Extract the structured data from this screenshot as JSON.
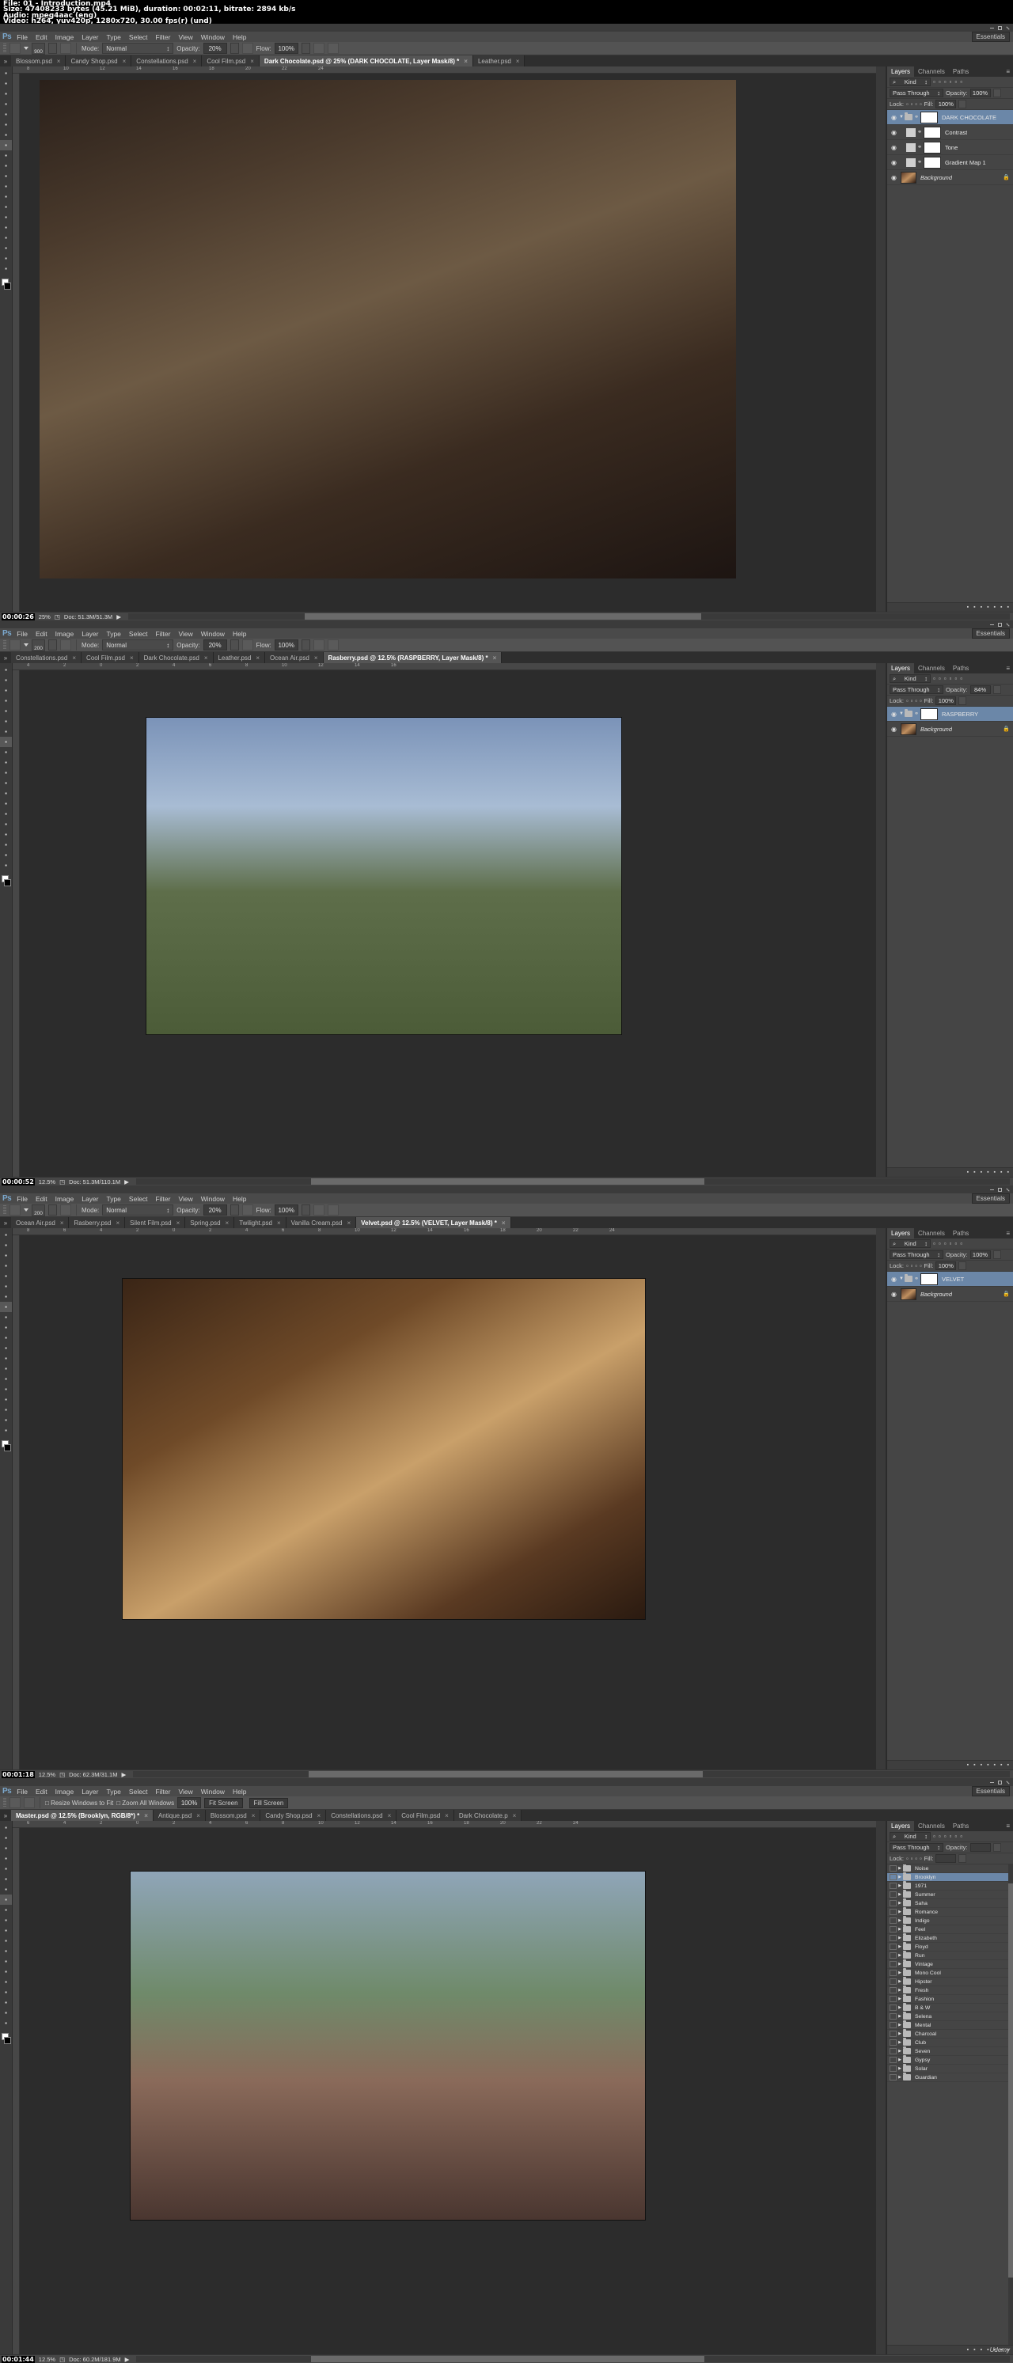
{
  "meta": {
    "line1": "File: 01 - Introduction.mp4",
    "line2": "Size: 47408233 bytes (45.21 MiB), duration: 00:02:11, bitrate: 2894 kb/s",
    "line3": "Audio: mpeg4aac (eng)",
    "line4": "Video: h264, yuv420p, 1280x720, 30.00 fps(r) (und)"
  },
  "menu": {
    "logo": "Ps",
    "items": [
      "File",
      "Edit",
      "Image",
      "Layer",
      "Type",
      "Select",
      "Filter",
      "View",
      "Window",
      "Help"
    ],
    "workspace": "Essentials"
  },
  "options_labels": {
    "mode": "Mode:",
    "opacity": "Opacity:",
    "flow": "Flow:"
  },
  "panel_tabs": {
    "layers": "Layers",
    "channels": "Channels",
    "paths": "Paths"
  },
  "layer_panel_labels": {
    "kind": "Kind",
    "opacity": "Opacity:",
    "fill": "Fill:",
    "lock": "Lock:"
  },
  "windows": [
    {
      "id": "dark-chocolate",
      "options": {
        "brush_size": "900",
        "mode": "Normal",
        "opacity": "20%",
        "flow": "100%"
      },
      "tabs": [
        {
          "label": "Blossom.psd",
          "active": false
        },
        {
          "label": "Candy Shop.psd",
          "active": false
        },
        {
          "label": "Constellations.psd",
          "active": false
        },
        {
          "label": "Cool Film.psd",
          "active": false
        },
        {
          "label": "Dark Chocolate.psd @ 25% (DARK CHOCOLATE, Layer Mask/8) *",
          "active": true
        },
        {
          "label": "Leather.psd",
          "active": false
        }
      ],
      "status": {
        "timecode": "00:00:26",
        "zoom": "25%",
        "doc": "Doc: 51.3M/51.3M"
      },
      "layers_header": {
        "blend": "Pass Through",
        "opacity": "100%",
        "fill": "100%"
      },
      "layers": [
        {
          "name": "DARK CHOCOLATE",
          "type": "group",
          "selected": true,
          "visible": true,
          "mask": true
        },
        {
          "name": "Contrast",
          "type": "adjustment",
          "selected": false,
          "visible": true,
          "mask": true
        },
        {
          "name": "Tone",
          "type": "adjustment",
          "selected": false,
          "visible": true,
          "mask": true
        },
        {
          "name": "Gradient Map 1",
          "type": "gradient",
          "selected": false,
          "visible": true,
          "mask": true
        },
        {
          "name": "Background",
          "type": "background",
          "selected": false,
          "visible": true,
          "locked": true
        }
      ],
      "ruler_ticks": [
        "8",
        "10",
        "12",
        "14",
        "16",
        "18",
        "20",
        "22",
        "24"
      ]
    },
    {
      "id": "rasberry",
      "options": {
        "brush_size": "200",
        "mode": "Normal",
        "opacity": "20%",
        "flow": "100%"
      },
      "tabs": [
        {
          "label": "Constellations.psd",
          "active": false
        },
        {
          "label": "Cool Film.psd",
          "active": false
        },
        {
          "label": "Dark Chocolate.psd",
          "active": false
        },
        {
          "label": "Leather.psd",
          "active": false
        },
        {
          "label": "Ocean Air.psd",
          "active": false
        },
        {
          "label": "Rasberry.psd @ 12.5% (RASPBERRY, Layer Mask/8) *",
          "active": true
        }
      ],
      "status": {
        "timecode": "00:00:52",
        "zoom": "12.5%",
        "doc": "Doc: 51.3M/110.1M"
      },
      "layers_header": {
        "blend": "Pass Through",
        "opacity": "84%",
        "fill": "100%"
      },
      "layers": [
        {
          "name": "RASPBERRY",
          "type": "group",
          "selected": true,
          "visible": true,
          "mask": true
        },
        {
          "name": "Background",
          "type": "background",
          "selected": false,
          "visible": true,
          "locked": true
        }
      ],
      "ruler_ticks": [
        "4",
        "2",
        "0",
        "2",
        "4",
        "6",
        "8",
        "10",
        "12",
        "14",
        "16"
      ]
    },
    {
      "id": "velvet",
      "options": {
        "brush_size": "200",
        "mode": "Normal",
        "opacity": "20%",
        "flow": "100%"
      },
      "tabs": [
        {
          "label": "Ocean Air.psd",
          "active": false
        },
        {
          "label": "Rasberry.psd",
          "active": false
        },
        {
          "label": "Silent Film.psd",
          "active": false
        },
        {
          "label": "Spring.psd",
          "active": false
        },
        {
          "label": "Twilight.psd",
          "active": false
        },
        {
          "label": "Vanilla Cream.psd",
          "active": false
        },
        {
          "label": "Velvet.psd @ 12.5% (VELVET, Layer Mask/8) *",
          "active": true
        }
      ],
      "status": {
        "timecode": "00:01:18",
        "zoom": "12.5%",
        "doc": "Doc: 62.3M/31.1M"
      },
      "layers_header": {
        "blend": "Pass Through",
        "opacity": "100%",
        "fill": "100%"
      },
      "layers": [
        {
          "name": "VELVET",
          "type": "group",
          "selected": true,
          "visible": true,
          "mask": true
        },
        {
          "name": "Background",
          "type": "background",
          "selected": false,
          "visible": true,
          "locked": true
        }
      ],
      "ruler_ticks": [
        "8",
        "6",
        "4",
        "2",
        "0",
        "2",
        "4",
        "6",
        "8",
        "10",
        "12",
        "14",
        "16",
        "18",
        "20",
        "22",
        "24"
      ]
    },
    {
      "id": "master",
      "options_zoom": {
        "resize_windows": "Resize Windows to Fit",
        "zoom_all": "Zoom All Windows",
        "pct": "100%",
        "fit_screen": "Fit Screen",
        "fill_screen": "Fill Screen"
      },
      "tabs": [
        {
          "label": "Master.psd @ 12.5% (Brooklyn, RGB/8*) *",
          "active": true
        },
        {
          "label": "Antique.psd",
          "active": false
        },
        {
          "label": "Blossom.psd",
          "active": false
        },
        {
          "label": "Candy Shop.psd",
          "active": false
        },
        {
          "label": "Constellations.psd",
          "active": false
        },
        {
          "label": "Cool Film.psd",
          "active": false
        },
        {
          "label": "Dark Chocolate.p",
          "active": false
        }
      ],
      "status": {
        "timecode": "00:01:44",
        "zoom": "12.5%",
        "doc": "Doc: 60.2M/181.9M"
      },
      "layers_header": {
        "blend": "Pass Through",
        "opacity": "",
        "fill": ""
      },
      "folders": [
        {
          "name": "Noise",
          "selected": false
        },
        {
          "name": "Brooklyn",
          "selected": true
        },
        {
          "name": "1971",
          "selected": false
        },
        {
          "name": "Summer",
          "selected": false
        },
        {
          "name": "Saha",
          "selected": false
        },
        {
          "name": "Romance",
          "selected": false
        },
        {
          "name": "Indigo",
          "selected": false
        },
        {
          "name": "Feel",
          "selected": false
        },
        {
          "name": "Elizabeth",
          "selected": false
        },
        {
          "name": "Floyd",
          "selected": false
        },
        {
          "name": "Run",
          "selected": false
        },
        {
          "name": "Vintage",
          "selected": false
        },
        {
          "name": "Mono Cool",
          "selected": false
        },
        {
          "name": "Hipster",
          "selected": false
        },
        {
          "name": "Fresh",
          "selected": false
        },
        {
          "name": "Fashion",
          "selected": false
        },
        {
          "name": "B & W",
          "selected": false
        },
        {
          "name": "Selena",
          "selected": false
        },
        {
          "name": "Mental",
          "selected": false
        },
        {
          "name": "Charcoal",
          "selected": false
        },
        {
          "name": "Club",
          "selected": false
        },
        {
          "name": "Seven",
          "selected": false
        },
        {
          "name": "Gypsy",
          "selected": false
        },
        {
          "name": "Solar",
          "selected": false
        },
        {
          "name": "Guardian",
          "selected": false
        }
      ],
      "watermark": "Udemy",
      "ruler_ticks": [
        "6",
        "4",
        "2",
        "0",
        "2",
        "4",
        "6",
        "8",
        "10",
        "12",
        "14",
        "16",
        "18",
        "20",
        "22",
        "24"
      ]
    }
  ],
  "colors": {
    "accent_selected_layer": "#6b87a8",
    "panel_bg": "#383838",
    "canvas_bg": "#2a2a2a",
    "options_bar": "#535353",
    "ps_logo_blue": "#7aa7cc"
  }
}
